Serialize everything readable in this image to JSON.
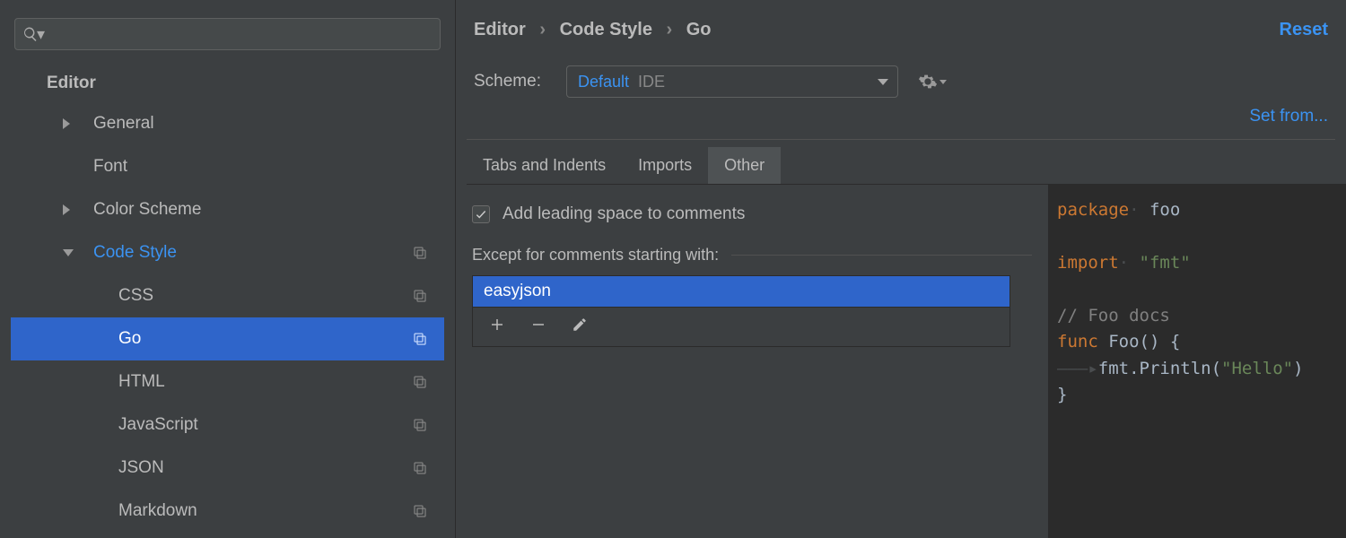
{
  "sidebar": {
    "root_label": "Editor",
    "items": [
      {
        "label": "General",
        "has_arrow": "right",
        "level": 2,
        "copy": false
      },
      {
        "label": "Font",
        "has_arrow": "",
        "level": 2,
        "copy": false
      },
      {
        "label": "Color Scheme",
        "has_arrow": "right",
        "level": 2,
        "copy": false
      },
      {
        "label": "Code Style",
        "has_arrow": "down",
        "level": 2,
        "copy": true,
        "color": "blue"
      },
      {
        "label": "CSS",
        "has_arrow": "",
        "level": 3,
        "copy": true
      },
      {
        "label": "Go",
        "has_arrow": "",
        "level": 3,
        "copy": true,
        "selected": true
      },
      {
        "label": "HTML",
        "has_arrow": "",
        "level": 3,
        "copy": true
      },
      {
        "label": "JavaScript",
        "has_arrow": "",
        "level": 3,
        "copy": true
      },
      {
        "label": "JSON",
        "has_arrow": "",
        "level": 3,
        "copy": true
      },
      {
        "label": "Markdown",
        "has_arrow": "",
        "level": 3,
        "copy": true
      }
    ]
  },
  "breadcrumb": {
    "a": "Editor",
    "b": "Code Style",
    "c": "Go"
  },
  "reset_label": "Reset",
  "scheme": {
    "label": "Scheme:",
    "name": "Default",
    "kind": "IDE"
  },
  "setfrom_label": "Set from...",
  "tabs": {
    "a": "Tabs and Indents",
    "b": "Imports",
    "c": "Other"
  },
  "checkbox_label": "Add leading space to comments",
  "except_label": "Except for comments starting with:",
  "list_entry": "easyjson",
  "code": {
    "l1a": "package",
    "l1b": " foo",
    "l2a": "import",
    "l2b": " \"fmt\"",
    "l3": "// Foo docs",
    "l4a": "func",
    "l4b": " Foo() {",
    "l5ws": "———▸",
    "l5": "fmt.Println(",
    "l5s": "\"Hello\"",
    "l5e": ")",
    "l6": "}"
  }
}
